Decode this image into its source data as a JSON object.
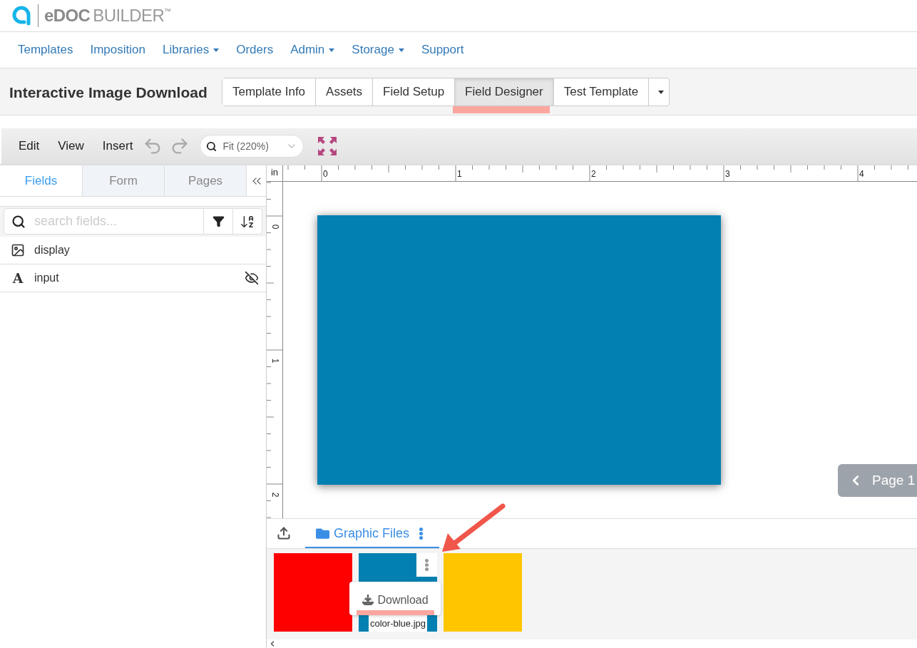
{
  "logo": {
    "brand": "eDOC",
    "product": "BUILDER",
    "mark": "™"
  },
  "nav": [
    {
      "label": "Templates",
      "dropdown": false
    },
    {
      "label": "Imposition",
      "dropdown": false
    },
    {
      "label": "Libraries",
      "dropdown": true
    },
    {
      "label": "Orders",
      "dropdown": false
    },
    {
      "label": "Admin",
      "dropdown": true
    },
    {
      "label": "Storage",
      "dropdown": true
    },
    {
      "label": "Support",
      "dropdown": false
    }
  ],
  "title": "Interactive Image Download",
  "tabs": [
    {
      "label": "Template Info",
      "selected": false
    },
    {
      "label": "Assets",
      "selected": false
    },
    {
      "label": "Field Setup",
      "selected": false
    },
    {
      "label": "Field Designer",
      "selected": true
    },
    {
      "label": "Test Template",
      "selected": false
    }
  ],
  "toolbar": {
    "menus": [
      "Edit",
      "View",
      "Insert"
    ],
    "zoom": "Fit (220%)"
  },
  "panel_tabs": [
    {
      "label": "Fields",
      "selected": true
    },
    {
      "label": "Form",
      "selected": false
    },
    {
      "label": "Pages",
      "selected": false
    }
  ],
  "search": {
    "placeholder": "search fields..."
  },
  "fields": [
    {
      "name": "display",
      "kind": "image",
      "hidden": false
    },
    {
      "name": "input",
      "kind": "text",
      "glyph": "A",
      "hidden": true
    }
  ],
  "ruler": {
    "unit": "in",
    "top_labels": [
      "0",
      "1",
      "2",
      "3",
      "4"
    ],
    "left_labels": [
      "0",
      "1",
      "2"
    ]
  },
  "page_nav": {
    "label": "Page 1"
  },
  "files_tab": {
    "label": "Graphic Files"
  },
  "files": [
    {
      "color": "#ff0000",
      "menu_open": false
    },
    {
      "color": "#0280b1",
      "name": "color-blue.jpg",
      "menu_open": true,
      "menu": [
        "Download"
      ]
    },
    {
      "color": "#ffc600",
      "menu_open": false
    }
  ]
}
